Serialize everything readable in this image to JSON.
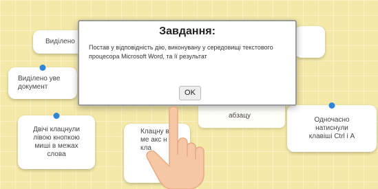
{
  "dialog": {
    "title": "Завдання:",
    "text": "Постав у відповідність дію, виконувану у середовищі текстового процесора Microsoft Word, та її результат",
    "ok_label": "OK"
  },
  "cards": {
    "top_left": "Виділено",
    "left_upper": "Виділено уве документ",
    "left_lower": "Двічі клацнули лівою кнопкою миші в межах слова",
    "bottom_center": "Клацну в ме акс н кла",
    "middle_right": "абзацу",
    "right": "Одночасно натиснули клавіші Ctrl і A"
  }
}
